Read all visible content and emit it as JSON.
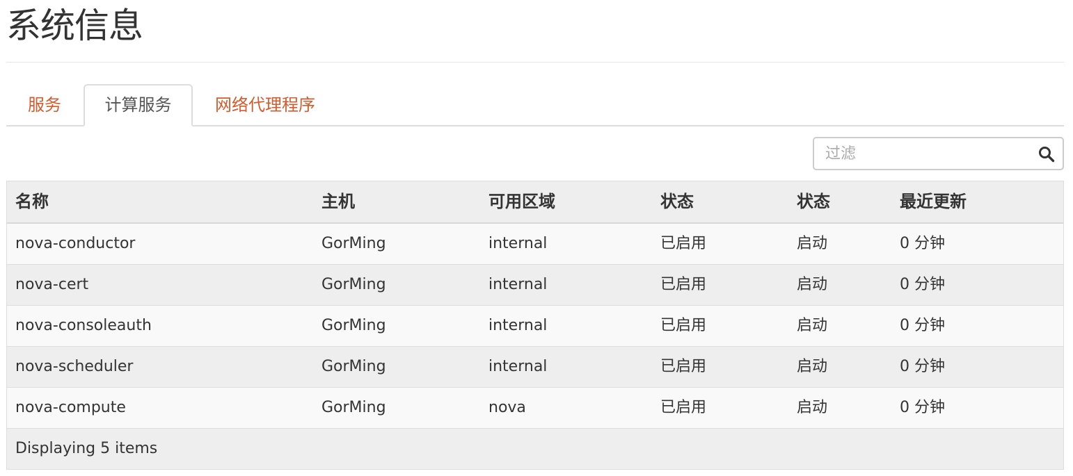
{
  "page": {
    "title": "系统信息"
  },
  "tabs": [
    {
      "label": "服务",
      "active": false
    },
    {
      "label": "计算服务",
      "active": true
    },
    {
      "label": "网络代理程序",
      "active": false
    }
  ],
  "filter": {
    "placeholder": "过滤",
    "value": ""
  },
  "table": {
    "columns": [
      "名称",
      "主机",
      "可用区域",
      "状态",
      "状态",
      "最近更新"
    ],
    "rows": [
      [
        "nova-conductor",
        "GorMing",
        "internal",
        "已启用",
        "启动",
        "0 分钟"
      ],
      [
        "nova-cert",
        "GorMing",
        "internal",
        "已启用",
        "启动",
        "0 分钟"
      ],
      [
        "nova-consoleauth",
        "GorMing",
        "internal",
        "已启用",
        "启动",
        "0 分钟"
      ],
      [
        "nova-scheduler",
        "GorMing",
        "internal",
        "已启用",
        "启动",
        "0 分钟"
      ],
      [
        "nova-compute",
        "GorMing",
        "nova",
        "已启用",
        "启动",
        "0 分钟"
      ]
    ],
    "footer": "Displaying 5 items"
  },
  "icons": {
    "search": "search-icon"
  },
  "colors": {
    "tab_link": "#d55a2c",
    "header_bg": "#eeeeee",
    "row_alt": "#f9f9f9"
  }
}
